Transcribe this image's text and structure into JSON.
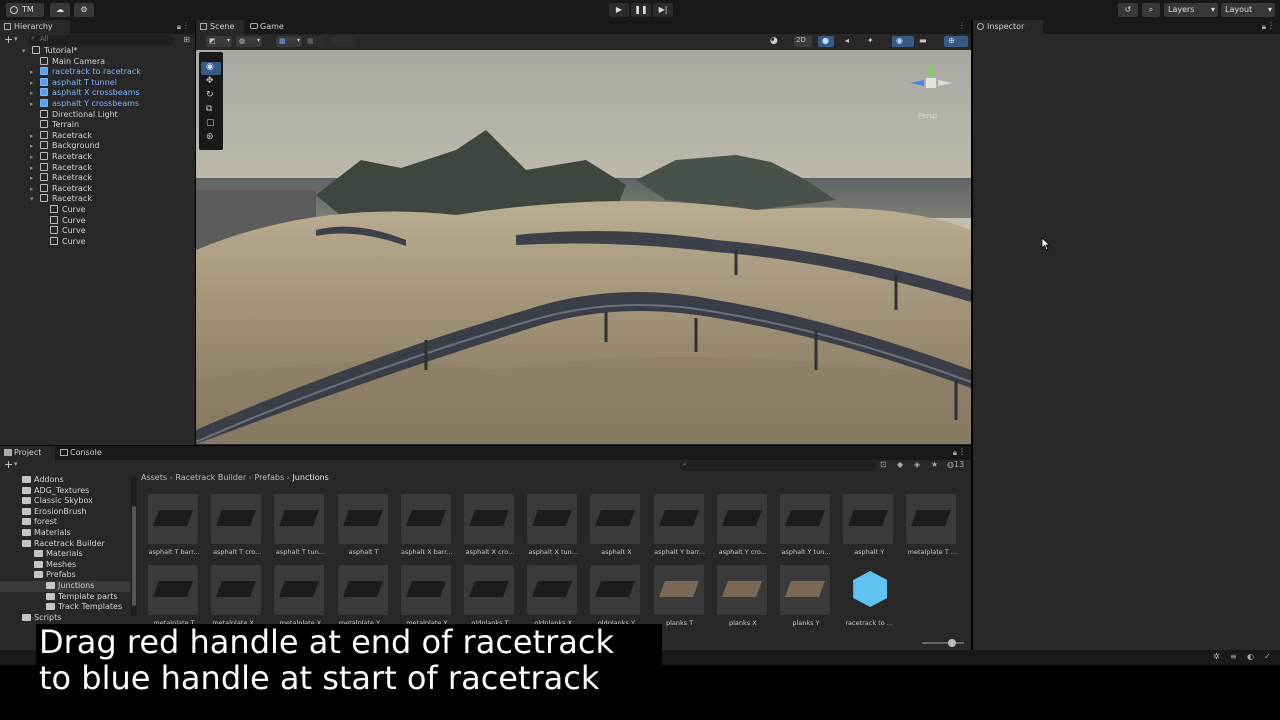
{
  "toolbar": {
    "account_label": "TM",
    "layers_label": "Layers",
    "layout_label": "Layout"
  },
  "hierarchy": {
    "tab_label": "Hierarchy",
    "search_placeholder": "All",
    "items": [
      {
        "label": "Tutorial*",
        "indent": 0,
        "prefab": false
      },
      {
        "label": "Main Camera",
        "indent": 1,
        "prefab": false
      },
      {
        "label": "racetrack to racetrack",
        "indent": 1,
        "prefab": true
      },
      {
        "label": "asphalt T tunnel",
        "indent": 1,
        "prefab": true
      },
      {
        "label": "asphalt X crossbeams",
        "indent": 1,
        "prefab": true
      },
      {
        "label": "asphalt Y crossbeams",
        "indent": 1,
        "prefab": true
      },
      {
        "label": "Directional Light",
        "indent": 1,
        "prefab": false
      },
      {
        "label": "Terrain",
        "indent": 1,
        "prefab": false
      },
      {
        "label": "Racetrack",
        "indent": 1,
        "prefab": false
      },
      {
        "label": "Background",
        "indent": 1,
        "prefab": false
      },
      {
        "label": "Racetrack",
        "indent": 1,
        "prefab": false
      },
      {
        "label": "Racetrack",
        "indent": 1,
        "prefab": false
      },
      {
        "label": "Racetrack",
        "indent": 1,
        "prefab": false
      },
      {
        "label": "Racetrack",
        "indent": 1,
        "prefab": false
      },
      {
        "label": "Racetrack",
        "indent": 1,
        "prefab": false
      },
      {
        "label": "Curve",
        "indent": 2,
        "prefab": false
      },
      {
        "label": "Curve",
        "indent": 2,
        "prefab": false
      },
      {
        "label": "Curve",
        "indent": 2,
        "prefab": false
      },
      {
        "label": "Curve",
        "indent": 2,
        "prefab": false
      }
    ]
  },
  "scene": {
    "tab_scene": "Scene",
    "tab_game": "Game",
    "mode_2d": "2D",
    "gizmo_label": "Persp"
  },
  "inspector": {
    "tab_label": "Inspector"
  },
  "project": {
    "tab_project": "Project",
    "tab_console": "Console",
    "badge_count": "13",
    "folders": [
      {
        "label": "Addons",
        "indent": 1
      },
      {
        "label": "ADG_Textures",
        "indent": 1
      },
      {
        "label": "Classic Skybox",
        "indent": 1
      },
      {
        "label": "ErosionBrush",
        "indent": 1
      },
      {
        "label": "forest",
        "indent": 1
      },
      {
        "label": "Materials",
        "indent": 1
      },
      {
        "label": "Racetrack Builder",
        "indent": 1
      },
      {
        "label": "Materials",
        "indent": 2
      },
      {
        "label": "Meshes",
        "indent": 2
      },
      {
        "label": "Prefabs",
        "indent": 2
      },
      {
        "label": "Junctions",
        "indent": 3
      },
      {
        "label": "Template parts",
        "indent": 3
      },
      {
        "label": "Track Templates",
        "indent": 3
      },
      {
        "label": "Scripts",
        "indent": 1
      }
    ],
    "breadcrumb": [
      "Assets",
      "Racetrack Builder",
      "Prefabs",
      "Junctions"
    ],
    "assets_row1": [
      "asphalt T barr...",
      "asphalt T cro...",
      "asphalt T tun...",
      "asphalt T",
      "asphalt X barr...",
      "asphalt X cro...",
      "asphalt X tun...",
      "asphalt X",
      "asphalt Y barr...",
      "asphalt Y cro...",
      "asphalt Y tun...",
      "asphalt Y",
      "metalplate T ..."
    ],
    "assets_row2": [
      "metalplate T",
      "metalplate X ...",
      "metalplate X",
      "metalplate Y ...",
      "metalplate Y",
      "oldplanks T",
      "oldplanks X",
      "oldplanks Y",
      "planks T",
      "planks X",
      "planks Y",
      "racetrack to ..."
    ]
  },
  "caption": {
    "line1": "Drag red handle at end of racetrack",
    "line2": "to blue handle at start of racetrack"
  }
}
